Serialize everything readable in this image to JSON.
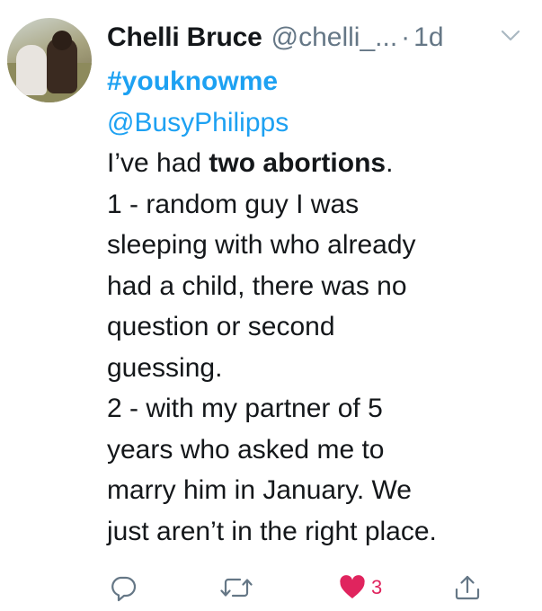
{
  "tweet": {
    "display_name": "Chelli Bruce",
    "handle": "@chelli_...",
    "separator": "·",
    "time": "1d",
    "hashtag": "#youknowme",
    "mention": "@BusyPhilipps",
    "lines": {
      "l1_pre": "I’ve had ",
      "l1_bold": "two abortions",
      "l1_post": ".",
      "l2": "1 - random guy I was",
      "l3": "sleeping with who already",
      "l4": "had a child, there was no",
      "l5": "question or second",
      "l6": "guessing.",
      "l7": "2 - with my partner of 5",
      "l8": "years who asked me to",
      "l9": "marry him in January. We",
      "l10": "just aren’t in the right place."
    },
    "like_count": "3"
  },
  "icons": {
    "reply": "reply-icon",
    "retweet": "retweet-icon",
    "like": "heart-icon",
    "share": "share-icon",
    "menu": "chevron-down-icon"
  },
  "colors": {
    "link": "#1da1f2",
    "muted": "#657786",
    "like": "#e0245e"
  }
}
